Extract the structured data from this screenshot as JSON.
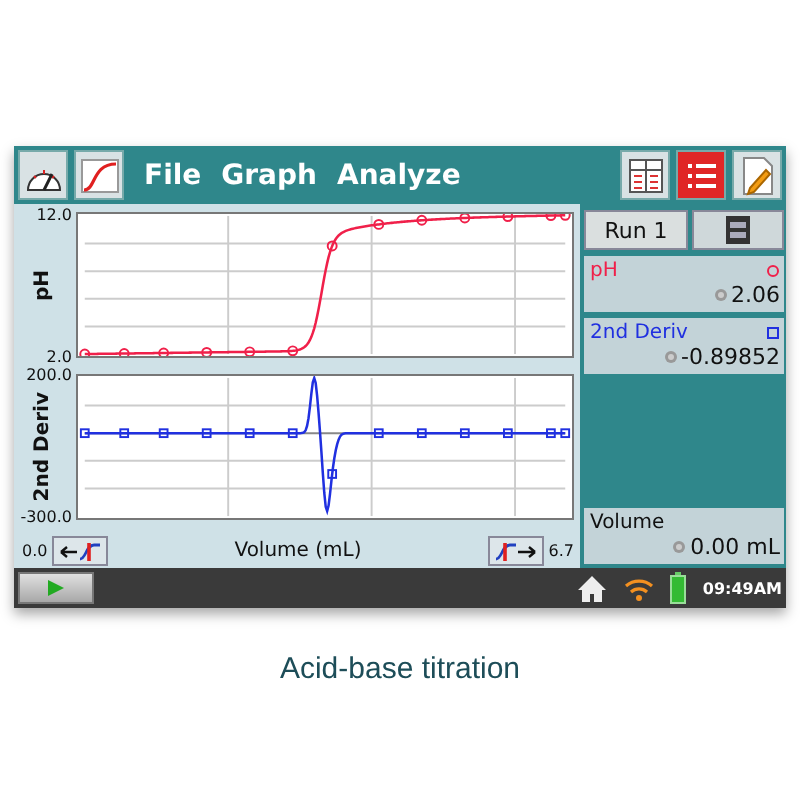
{
  "toolbar": {
    "menus": [
      "File",
      "Graph",
      "Analyze"
    ]
  },
  "graphs": [
    {
      "kind": "sigmoid",
      "ylabel": "pH",
      "y_max": "12.0",
      "y_min": "2.0",
      "color": "#f0204a"
    },
    {
      "kind": "spike",
      "ylabel": "2nd Deriv",
      "y_max": "200.0",
      "y_min": "-300.0",
      "color": "#2030e0"
    }
  ],
  "x_axis": {
    "min": "0.0",
    "label": "Volume (mL)",
    "max": "6.7"
  },
  "run": {
    "label": "Run 1"
  },
  "meters": [
    {
      "kind": "circle",
      "name": "pH",
      "value": "2.06",
      "color": "#f0204a"
    },
    {
      "kind": "square",
      "name": "2nd Deriv",
      "value": "-0.89852",
      "color": "#2030e0"
    },
    {
      "kind": "plain",
      "name": "Volume",
      "value": "0.00 mL"
    }
  ],
  "status_bar": {
    "time": "09:49AM"
  },
  "caption": "Acid-base titration"
}
